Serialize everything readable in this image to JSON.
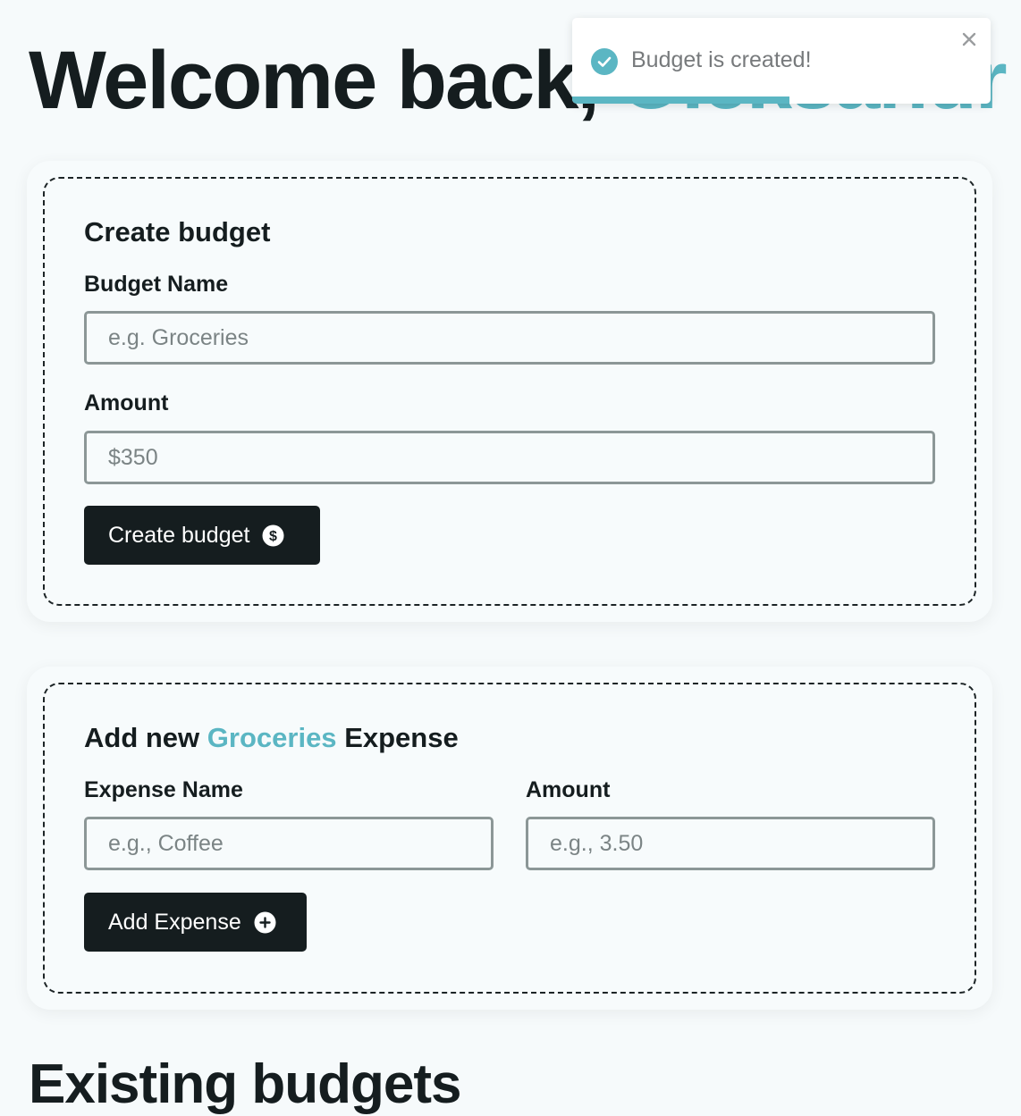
{
  "header": {
    "welcome_prefix": "Welcome back, ",
    "user_name": "Oleksandr"
  },
  "toast": {
    "message": "Budget is created!",
    "icon": "check-circle-icon",
    "close_icon": "close-icon",
    "progress_fraction": 0.52
  },
  "create_budget": {
    "title": "Create budget",
    "name_label": "Budget Name",
    "name_placeholder": "e.g. Groceries",
    "amount_label": "Amount",
    "amount_placeholder": "$350",
    "button_label": "Create budget",
    "button_icon": "dollar-circle-icon"
  },
  "add_expense": {
    "title_prefix": "Add new",
    "budget_name": "Groceries",
    "title_suffix": "Expense",
    "name_label": "Expense Name",
    "name_placeholder": "e.g., Coffee",
    "amount_label": "Amount",
    "amount_placeholder": "e.g., 3.50",
    "button_label": "Add Expense",
    "button_icon": "plus-circle-icon"
  },
  "existing_budgets": {
    "title": "Existing budgets"
  },
  "colors": {
    "accent": "#5bb6c3",
    "dark": "#151d1f",
    "background": "#f6fafb",
    "input_border": "#8c9797"
  }
}
